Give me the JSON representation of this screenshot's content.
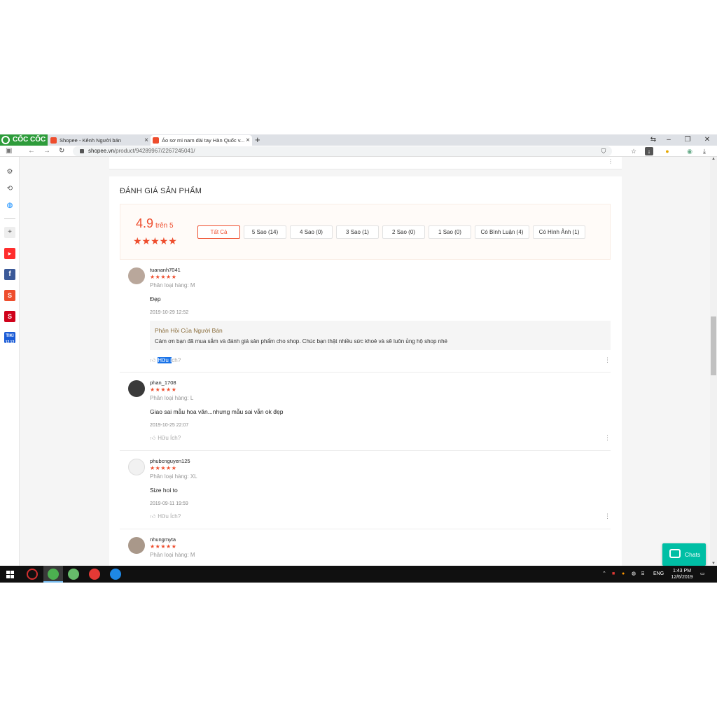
{
  "browser": {
    "brand": "CỐC CỐC",
    "tabs": [
      {
        "title": "Shopee - Kênh Người bán"
      },
      {
        "title": "Áo sơ mi nam dài tay Hàn Quốc v..."
      }
    ],
    "url_host": "shopee.vn",
    "url_path": "/product/94289967/2267245041/"
  },
  "section": {
    "title": "ĐÁNH GIÁ SẢN PHẨM",
    "score": "4.9",
    "score_suffix": "trên 5",
    "stars": "★★★★★"
  },
  "filters": [
    {
      "label": "Tất Cả",
      "active": true
    },
    {
      "label": "5 Sao (14)"
    },
    {
      "label": "4 Sao (0)"
    },
    {
      "label": "3 Sao (1)"
    },
    {
      "label": "2 Sao (0)"
    },
    {
      "label": "1 Sao (0)"
    },
    {
      "label": "Có Bình Luận (4)"
    },
    {
      "label": "Có Hình Ảnh (1)"
    }
  ],
  "reviews": [
    {
      "username": "tuananh7041",
      "stars": "★★★★★",
      "variation": "Phân loại hàng: M",
      "comment": "Đẹp",
      "time": "2019-10-29 12:52",
      "reply_title": "Phản Hồi Của Người Bán",
      "reply_text": "Cảm ơn bạn đã mua sắm và đánh giá sản phẩm cho shop. Chúc bạn thật nhiều sức khoẻ và sẽ luôn ủng hộ shop nhé",
      "helpful_selected": "Hữu í",
      "helpful_rest": "ch?"
    },
    {
      "username": "phan_1708",
      "stars": "★★★★★",
      "variation": "Phân loại hàng: L",
      "comment": "Giao sai mẫu hoa văn...nhưng mẫu sai vẫn ok đẹp",
      "time": "2019-10-25 22:07",
      "helpful": "Hữu Ích?"
    },
    {
      "username": "phubcnguyen125",
      "stars": "★★★★★",
      "variation": "Phân loại hàng: XL",
      "comment": "Size hoi to",
      "time": "2019-09-11 19:59",
      "helpful": "Hữu Ích?"
    },
    {
      "username": "nhungmyta",
      "stars": "★★★★★",
      "variation": "Phân loại hàng: M"
    }
  ],
  "chat": {
    "label": "Chats"
  },
  "taskbar": {
    "lang": "ENG",
    "time": "1:43 PM",
    "date": "12/6/2019"
  },
  "sidebar_apps": {
    "tiki_line1": "TIKI",
    "tiki_line2": "12.12"
  },
  "colors": {
    "accent": "#ee4d2d",
    "chat": "#00bfa5",
    "brand_green": "#2e9c3b"
  }
}
